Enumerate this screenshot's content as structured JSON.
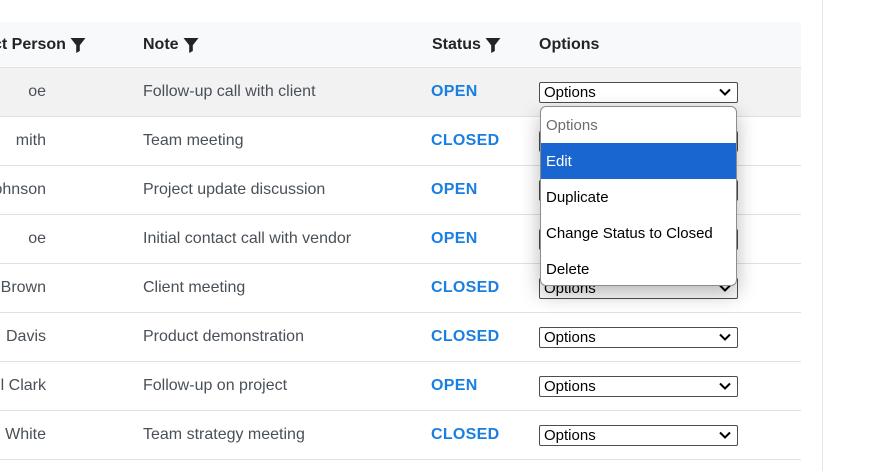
{
  "header": {
    "contact_person": "ct Person",
    "note": "Note",
    "status": "Status",
    "options": "Options"
  },
  "rows": [
    {
      "person": "oe",
      "note": "Follow-up call with client",
      "status": "OPEN",
      "option": "Options"
    },
    {
      "person": "mith",
      "note": "Team meeting",
      "status": "CLOSED",
      "option": "Options"
    },
    {
      "person": "ohnson",
      "note": "Project update discussion",
      "status": "OPEN",
      "option": "Options"
    },
    {
      "person": "oe",
      "note": "Initial contact call with vendor",
      "status": "OPEN",
      "option": "Options"
    },
    {
      "person": "Brown",
      "note": "Client meeting",
      "status": "CLOSED",
      "option": "Options"
    },
    {
      "person": "Davis",
      "note": "Product demonstration",
      "status": "CLOSED",
      "option": "Options"
    },
    {
      "person": "l Clark",
      "note": "Follow-up on project",
      "status": "OPEN",
      "option": "Options"
    },
    {
      "person": "White",
      "note": "Team strategy meeting",
      "status": "CLOSED",
      "option": "Options"
    }
  ],
  "dropdown": {
    "items": [
      "Options",
      "Edit",
      "Duplicate",
      "Change Status to Closed",
      "Delete"
    ],
    "selected": "Edit"
  },
  "colors": {
    "status_text": "#1a7fe0",
    "selected_option_bg": "#1a66d1",
    "header_bg": "#f8f9fa",
    "hover_row_bg": "#f2f2f2"
  },
  "icons": {
    "filter": "filter-icon",
    "chevron": "chevron-down-icon"
  }
}
